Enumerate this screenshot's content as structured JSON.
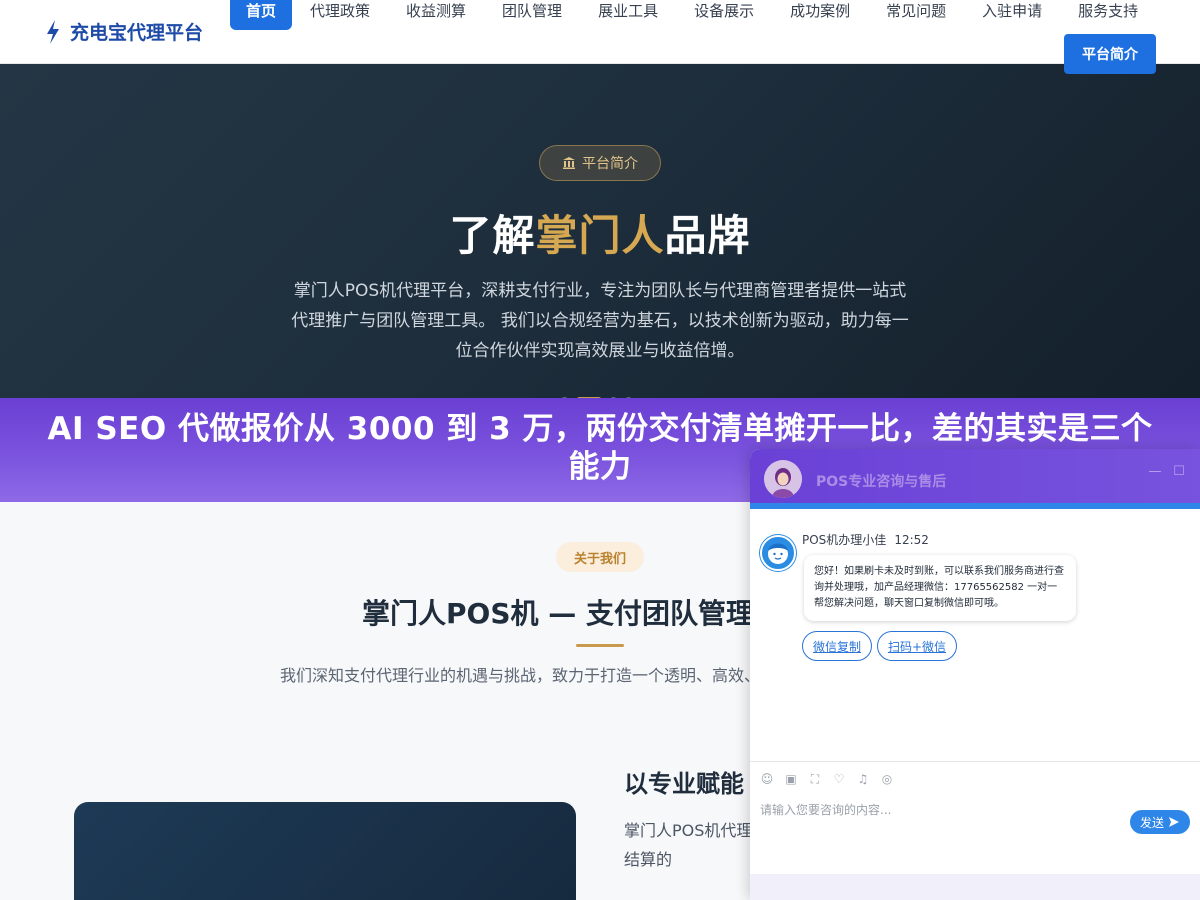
{
  "header": {
    "logo_text": "充电宝代理平台",
    "nav": [
      {
        "label": "首页",
        "active": true
      },
      {
        "label": "代理政策"
      },
      {
        "label": "收益测算"
      },
      {
        "label": "团队管理"
      },
      {
        "label": "展业工具"
      },
      {
        "label": "设备展示"
      },
      {
        "label": "成功案例"
      },
      {
        "label": "常见问题"
      },
      {
        "label": "入驻申请"
      },
      {
        "label": "服务支持"
      }
    ],
    "cta_label": "平台简介",
    "accent_color": "#1e6fe0"
  },
  "hero": {
    "pill_label": "平台简介",
    "title_pre": "了解",
    "title_gold": "掌门人",
    "title_post": "品牌",
    "description": "掌门人POS机代理平台，深耕支付行业，专注为团队长与代理商管理者提供一站式代理推广与团队管理工具。 我们以合规经营为基石，以技术创新为驱动，助力每一位合作伙伴实现高效展业与收益倍增。",
    "slides_total": 4,
    "slide_active": 2
  },
  "banner": {
    "text": "AI SEO 代做报价从 3000 到 3 万，两份交付清单摊开一比，差的其实是三个能力"
  },
  "about": {
    "pill_label": "关于我们",
    "title": "掌门人POS机 — 支付团队管理",
    "description": "我们深知支付代理行业的机遇与挑战，致力于打造一个透明、高效、智能的团队管理平台。",
    "sub_title": "以专业赋能",
    "sub_description": "掌门人POS机代理平台深刻理解团队长在日常管理中的痛点，从培训，到佣金结算的"
  },
  "chat": {
    "title": "POS专业咨询与售后",
    "agent_name": "POS机办理小佳",
    "time": "12:52",
    "message": "您好！如果刷卡未及时到账，可以联系我们服务商进行查询并处理哦，加产品经理微信：17765562582 一对一帮您解决问题，聊天窗口复制微信即可哦。",
    "quick_replies": [
      "微信复制",
      "扫码+微信"
    ],
    "input_placeholder": "请输入您要咨询的内容...",
    "send_label": "发送",
    "icons": [
      "emoji-icon",
      "image-icon",
      "screenshot-icon",
      "evaluate-icon",
      "sound-icon",
      "wechat-icon"
    ]
  }
}
